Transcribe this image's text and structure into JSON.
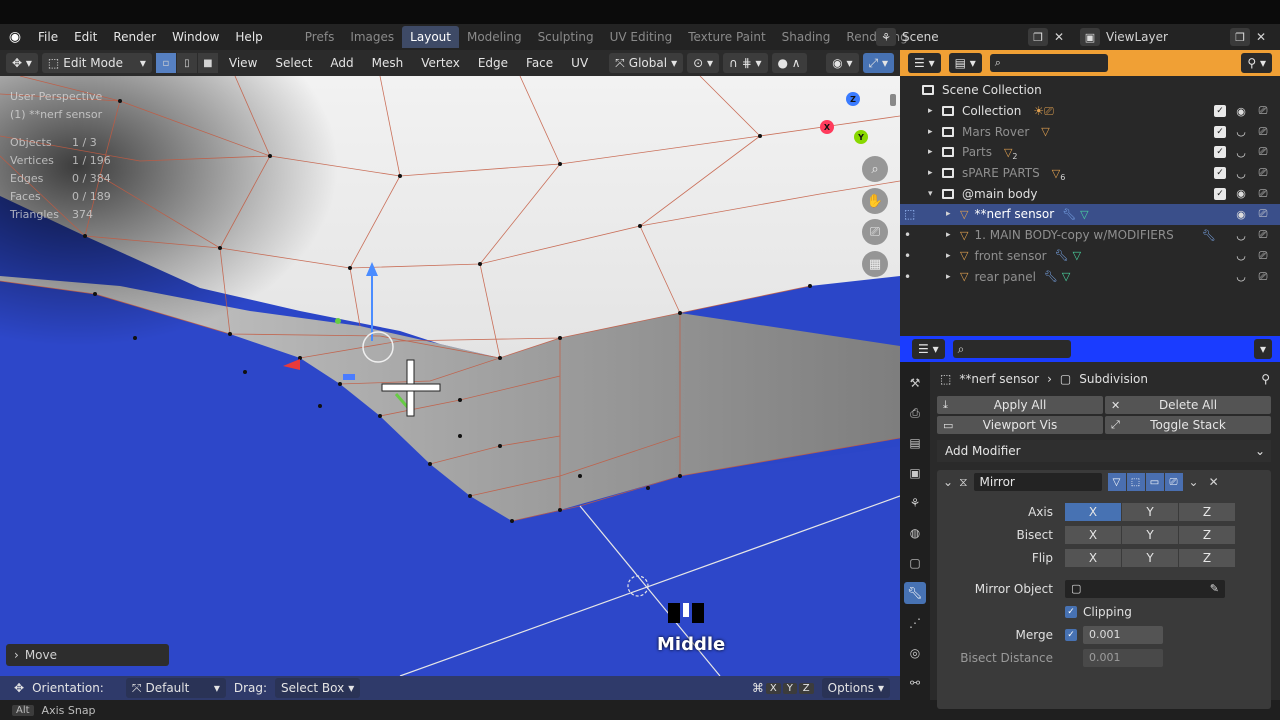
{
  "topbar": {
    "menus": [
      "File",
      "Edit",
      "Render",
      "Window",
      "Help"
    ],
    "workspaces": [
      "Prefs",
      "Images",
      "Layout",
      "Modeling",
      "Sculpting",
      "UV Editing",
      "Texture Paint",
      "Shading",
      "Rendering"
    ],
    "active_workspace": "Layout",
    "scene": "Scene",
    "view_layer": "ViewLayer"
  },
  "viewport_header": {
    "mode": "Edit Mode",
    "menus": [
      "View",
      "Select",
      "Add",
      "Mesh",
      "Vertex",
      "Edge",
      "Face",
      "UV"
    ],
    "orientation": "Global"
  },
  "viewport": {
    "perspective": "User Perspective",
    "object_label": "(1) **nerf sensor",
    "stats": [
      {
        "label": "Objects",
        "value": "1 / 3"
      },
      {
        "label": "Vertices",
        "value": "1 / 196"
      },
      {
        "label": "Edges",
        "value": "0 / 384"
      },
      {
        "label": "Faces",
        "value": "0 / 189"
      },
      {
        "label": "Triangles",
        "value": "374"
      }
    ],
    "gizmo": {
      "z": "Z",
      "y": "Y",
      "x": "X"
    },
    "last_op": "Move",
    "mouse_hint": "Middle"
  },
  "tool_settings": {
    "orientation_label": "Orientation:",
    "orientation_value": "Default",
    "drag_label": "Drag:",
    "drag_value": "Select Box",
    "axes": [
      "X",
      "Y",
      "Z"
    ],
    "options": "Options"
  },
  "status_bar": {
    "key": "Alt",
    "hint": "Axis Snap"
  },
  "outliner": {
    "rows": [
      {
        "label": "Scene Collection",
        "indent": 0,
        "kind": "scene",
        "dim": false,
        "selected": false
      },
      {
        "label": "Collection",
        "indent": 1,
        "kind": "coll",
        "dim": false,
        "selected": false
      },
      {
        "label": "Mars Rover",
        "indent": 1,
        "kind": "coll",
        "dim": true,
        "selected": false
      },
      {
        "label": "Parts",
        "indent": 1,
        "kind": "coll",
        "dim": true,
        "selected": false,
        "badge": "2"
      },
      {
        "label": "sPARE PARTS",
        "indent": 1,
        "kind": "coll",
        "dim": true,
        "selected": false,
        "badge": "6"
      },
      {
        "label": "@main body",
        "indent": 1,
        "kind": "coll",
        "dim": false,
        "selected": false
      },
      {
        "label": "**nerf sensor",
        "indent": 2,
        "kind": "mesh",
        "dim": false,
        "selected": true
      },
      {
        "label": "1. MAIN BODY-copy w/MODIFIERS",
        "indent": 2,
        "kind": "mesh",
        "dim": true,
        "selected": false
      },
      {
        "label": "front sensor",
        "indent": 2,
        "kind": "mesh",
        "dim": true,
        "selected": false
      },
      {
        "label": "rear panel",
        "indent": 2,
        "kind": "mesh",
        "dim": true,
        "selected": false
      }
    ]
  },
  "properties": {
    "object": "**nerf sensor",
    "modifier_context": "Subdivision",
    "buttons": [
      "Apply All",
      "Delete All",
      "Viewport Vis",
      "Toggle Stack"
    ],
    "add_modifier": "Add Modifier",
    "mirror": {
      "name": "Mirror",
      "axis_label": "Axis",
      "bisect_label": "Bisect",
      "flip_label": "Flip",
      "axes": [
        "X",
        "Y",
        "Z"
      ],
      "mirror_object_label": "Mirror Object",
      "clipping_label": "Clipping",
      "merge_label": "Merge",
      "merge_value": "0.001",
      "bisect_distance_label": "Bisect Distance",
      "bisect_distance_value": "0.001"
    }
  },
  "colors": {
    "outliner_header": "#f0a035",
    "properties_header": "#1a3cff",
    "viewport_bg": "#2b46c8",
    "selection": "#4772b3"
  }
}
